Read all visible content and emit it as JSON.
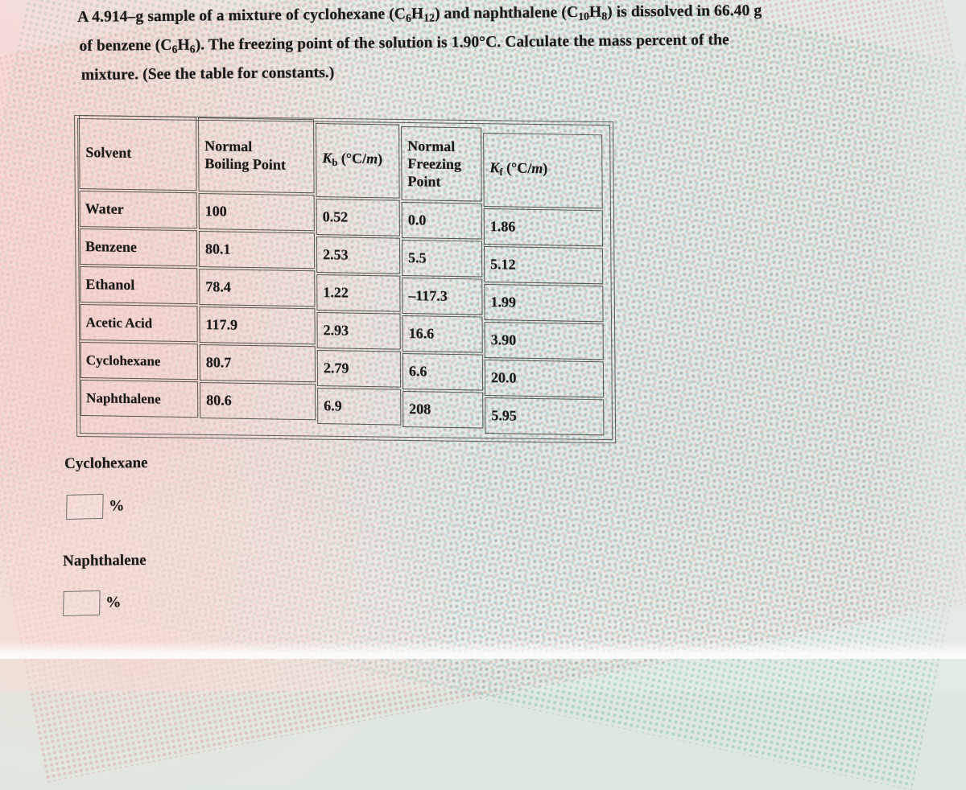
{
  "problem": {
    "line1": "A 4.914–g sample of a mixture of cyclohexane (C₆H₁₂) and naphthalene (C₁₀H₈) is dissolved in 66.40 g",
    "line2": "of benzene (C₆H₆). The freezing point of the solution is 1.90°C. Calculate the mass percent of the",
    "line3": "mixture. (See the table for constants.)",
    "sample_mass_g": "4.914",
    "solute_a": "cyclohexane",
    "solute_a_formula": "C6H12",
    "solute_b": "naphthalene",
    "solute_b_formula": "C10H8",
    "solvent": "benzene",
    "solvent_formula": "C6H6",
    "solvent_mass_g": "66.40",
    "freezing_point_c": "1.90"
  },
  "table": {
    "headers": [
      "Solvent",
      "Normal Boiling Point",
      "Kb (°C/m)",
      "Normal Freezing Point",
      "Kf (°C/m)"
    ],
    "header_parts": {
      "solvent": "Solvent",
      "bp_l1": "Normal",
      "bp_l2": "Boiling Point",
      "kb_sym": "K",
      "kb_sub": "b",
      "kb_unit": "(°C/m)",
      "fp_l1": "Normal",
      "fp_l2": "Freezing",
      "fp_l3": "Point",
      "kf_sym": "K",
      "kf_sub": "f",
      "kf_unit": "(°C/m)"
    },
    "rows": [
      {
        "solvent": "Water",
        "boiling_point": "100",
        "kb": "0.52",
        "freezing_point": "0.0",
        "kf": "1.86"
      },
      {
        "solvent": "Benzene",
        "boiling_point": "80.1",
        "kb": "2.53",
        "freezing_point": "5.5",
        "kf": "5.12"
      },
      {
        "solvent": "Ethanol",
        "boiling_point": "78.4",
        "kb": "1.22",
        "freezing_point": "–117.3",
        "kf": "1.99"
      },
      {
        "solvent": "Acetic Acid",
        "boiling_point": "117.9",
        "kb": "2.93",
        "freezing_point": "16.6",
        "kf": "3.90"
      },
      {
        "solvent": "Cyclohexane",
        "boiling_point": "80.7",
        "kb": "2.79",
        "freezing_point": "6.6",
        "kf": "20.0"
      },
      {
        "solvent": "Naphthalene",
        "boiling_point": "80.6",
        "kb": "6.9",
        "freezing_point": "208",
        "kf": "5.95"
      }
    ]
  },
  "answers": {
    "cyclohexane_label": "Cyclohexane",
    "cyclohexane_value": "",
    "cyclohexane_unit": "%",
    "naphthalene_label": "Naphthalene",
    "naphthalene_value": "",
    "naphthalene_unit": "%"
  },
  "colors": {
    "ink": "#1b1a18",
    "rule": "#55574f",
    "box_border": "#6e7070",
    "paper_green": "#e2eae6",
    "paper_pink": "#f4d6d6"
  }
}
